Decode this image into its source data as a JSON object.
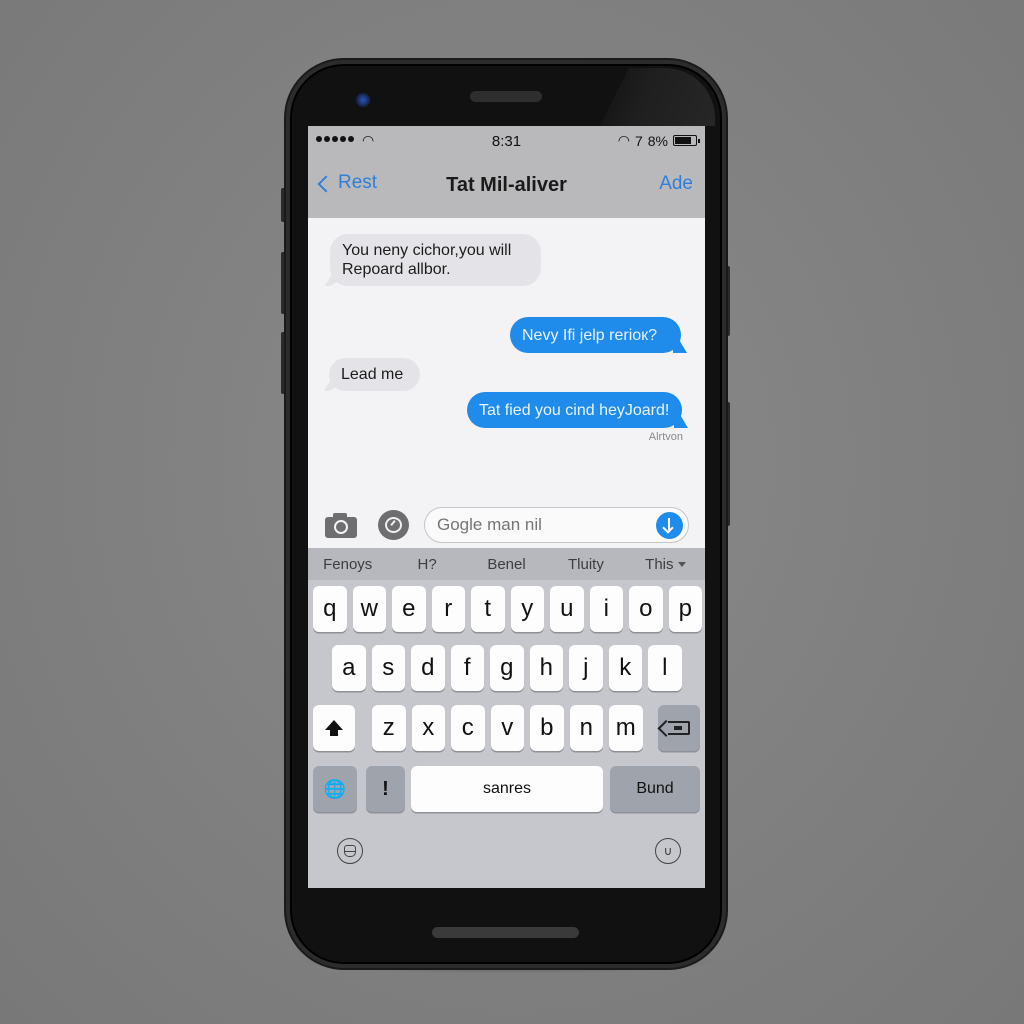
{
  "status_bar": {
    "signal_dots": 5,
    "time": "8:31",
    "battery_text": "8%",
    "extra_glyph": "7"
  },
  "nav": {
    "back_label": "Rest",
    "title": "Tat Mil-aliver",
    "action_label": "Ade"
  },
  "messages": [
    {
      "direction": "incoming",
      "text": "You neny cichor,you will Repoard allbor."
    },
    {
      "direction": "outgoing",
      "text": "Nevy Ifi jelp rerioк?"
    },
    {
      "direction": "incoming",
      "text": "Lead me"
    },
    {
      "direction": "outgoing",
      "text": "Tat fied you cind heyJoard!"
    }
  ],
  "receipt": "Alrtvon",
  "composer": {
    "placeholder": "Gogle man nil",
    "camera_icon": "camera-icon",
    "apps_icon": "app-store-icon",
    "send_icon": "send-arrow-icon"
  },
  "keyboard": {
    "suggestions": [
      "Fenoys",
      "H?",
      "Benel",
      "Tluity",
      "This"
    ],
    "row1": [
      "q",
      "w",
      "e",
      "r",
      "t",
      "y",
      "u",
      "i",
      "o",
      "p"
    ],
    "row2": [
      "a",
      "s",
      "d",
      "f",
      "g",
      "h",
      "j",
      "k",
      "l"
    ],
    "row3": [
      "z",
      "x",
      "c",
      "v",
      "b",
      "n",
      "m"
    ],
    "space_label": "sanres",
    "return_label": "Bund",
    "punct_label": "!",
    "globe_glyph": "🌐",
    "mic_glyph": "🎙"
  },
  "colors": {
    "accent": "#2f7fd8",
    "outgoing_bubble": "#1f8bea",
    "incoming_bubble": "#e4e4e8",
    "keyboard_bg": "#c5c7cc"
  }
}
